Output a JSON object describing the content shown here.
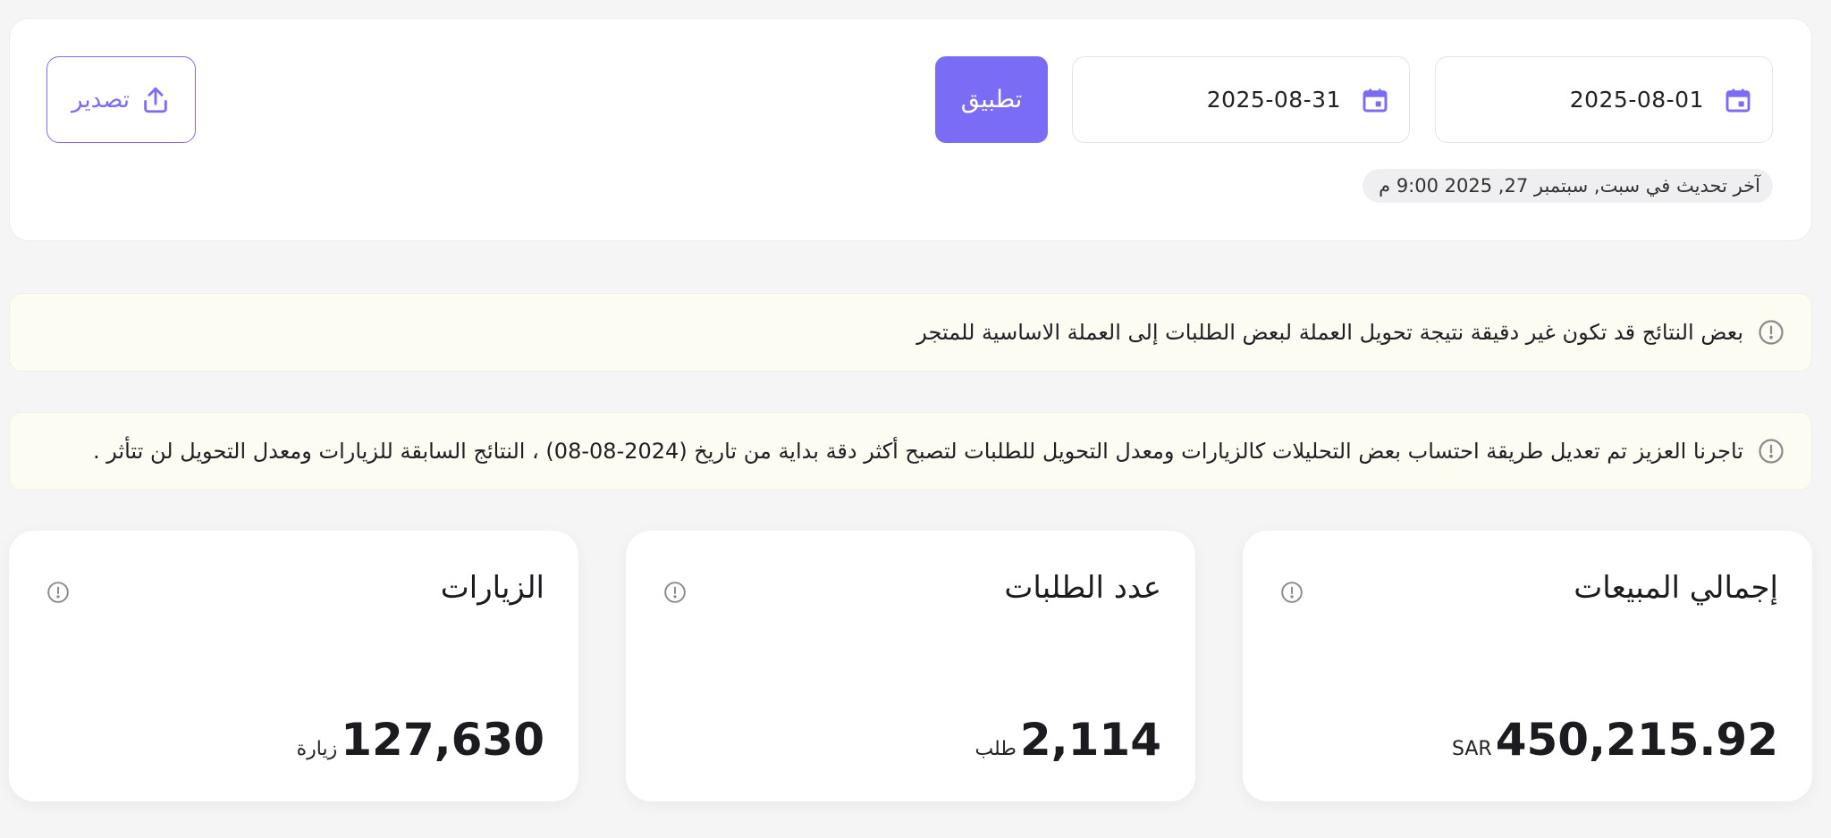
{
  "filters": {
    "start_date": "2025-08-01",
    "end_date": "2025-08-31",
    "apply_label": "تطبيق",
    "export_label": "تصدير",
    "last_updated": "آخر تحديث في سبت, سبتمبر 27, 2025 9:00 م"
  },
  "notices": [
    {
      "text": "بعض النتائج قد تكون غير دقيقة نتيجة تحويل العملة لبعض الطلبات إلى العملة الاساسية للمتجر",
      "icon": "info-icon"
    },
    {
      "text": "تاجرنا العزيز تم تعديل طريقة احتساب بعض التحليلات كالزيارات ومعدل التحويل للطلبات لتصبح أكثر دقة بداية من تاريخ (2024-08-08) ، النتائج السابقة للزيارات ومعدل التحويل لن تتأثر .",
      "icon": "info-icon"
    }
  ],
  "metrics": [
    {
      "title": "إجمالي المبيعات",
      "value": "450,215.92",
      "unit": "SAR"
    },
    {
      "title": "عدد الطلبات",
      "value": "2,114",
      "unit": "طلب"
    },
    {
      "title": "الزيارات",
      "value": "127,630",
      "unit": "زيارة"
    }
  ],
  "colors": {
    "accent": "#7b6cf6",
    "notice_bg": "#fdfcf3",
    "page_bg": "#f5f5f6"
  }
}
